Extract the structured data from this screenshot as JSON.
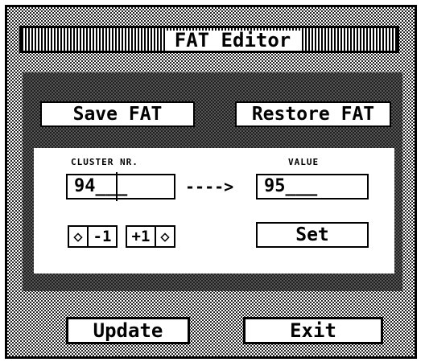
{
  "window": {
    "title": "FAT Editor"
  },
  "buttons": {
    "save_fat": "Save FAT",
    "restore_fat": "Restore FAT",
    "set": "Set",
    "update": "Update",
    "exit": "Exit"
  },
  "cluster": {
    "label": "CLUSTER NR.",
    "value": "94___",
    "decrement_icon": "◇",
    "decrement_label": "-1",
    "increment_label": "+1",
    "increment_icon": "◇"
  },
  "value_field": {
    "label": "VALUE",
    "value": "95___"
  },
  "arrow": "---->"
}
